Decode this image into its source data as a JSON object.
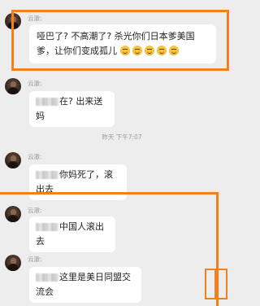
{
  "messages": [
    {
      "sender": "云澈:",
      "text": "哑巴了? 不高潮了? 杀光你们日本爹美国爹，让你们变成孤儿",
      "emoji_count": 5
    },
    {
      "sender": "云澈:",
      "text": "在? 出来送妈"
    },
    {
      "sender": "云澈:",
      "text": "你妈死了，滚出去"
    },
    {
      "sender": "云澈:",
      "text": "中国人滚出去"
    },
    {
      "sender": "云澈:",
      "text": "这里是美日同盟交流会"
    }
  ],
  "timestamp": "昨天 下午7:07",
  "colors": {
    "highlight": "#f0821e",
    "background": "#ededed",
    "bubble": "#ffffff"
  },
  "icons": {
    "avatar": "user-avatar-icon",
    "emoji": "grinning-emoji-icon",
    "redaction": "blurred-mention"
  }
}
